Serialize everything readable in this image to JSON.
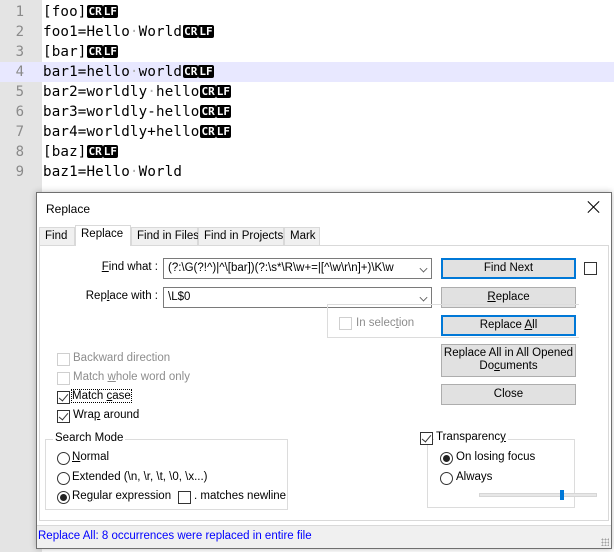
{
  "editor": {
    "current_line": 4,
    "eol_markers": [
      "CR",
      "LF"
    ],
    "lines": [
      {
        "num": "1",
        "text": "[foo]",
        "eol": true
      },
      {
        "num": "2",
        "text": "foo1=Hello·World",
        "eol": true
      },
      {
        "num": "3",
        "text": "[bar]",
        "eol": true
      },
      {
        "num": "4",
        "text": "bar1=hello·world",
        "eol": true
      },
      {
        "num": "5",
        "text": "bar2=worldly·hello",
        "eol": true
      },
      {
        "num": "6",
        "text": "bar3=worldly-hello",
        "eol": true
      },
      {
        "num": "7",
        "text": "bar4=worldly+hello",
        "eol": true
      },
      {
        "num": "8",
        "text": "[baz]",
        "eol": true
      },
      {
        "num": "9",
        "text": "baz1=Hello·World",
        "eol": false
      }
    ]
  },
  "dialog": {
    "title": "Replace",
    "close_icon": "close-icon",
    "tabs": [
      {
        "label": "Find",
        "active": false
      },
      {
        "label": "Replace",
        "active": true
      },
      {
        "label": "Find in Files",
        "active": false
      },
      {
        "label": "Find in Projects",
        "active": false
      },
      {
        "label": "Mark",
        "active": false
      }
    ],
    "find_what_label": "Find what :",
    "find_what_value": "(?:\\G(?!^)|^\\[bar])(?:\\s*\\R\\w+=|[^\\w\\r\\n]+)\\K\\w",
    "replace_with_label": "Replace with :",
    "replace_with_value": "\\L$0",
    "buttons": {
      "find_next": "Find Next",
      "replace": "Replace",
      "replace_all": "Replace All",
      "replace_all_opened": "Replace All in All Opened Documents",
      "close": "Close"
    },
    "in_selection": {
      "label": "In selection",
      "checked": false,
      "enabled": false
    },
    "options": [
      {
        "label": "Backward direction",
        "checked": false,
        "enabled": false
      },
      {
        "label": "Match whole word only",
        "checked": false,
        "enabled": false
      },
      {
        "label": "Match case",
        "checked": true,
        "enabled": true
      },
      {
        "label": "Wrap around",
        "checked": true,
        "enabled": true
      }
    ],
    "search_mode": {
      "title": "Search Mode",
      "options": [
        {
          "label": "Normal",
          "selected": false
        },
        {
          "label": "Extended (\\n, \\r, \\t, \\0, \\x...)",
          "selected": false
        },
        {
          "label": "Regular expression",
          "selected": true
        }
      ],
      "matches_newline": {
        "label": ". matches newline",
        "checked": false
      }
    },
    "transparency": {
      "label": "Transparency",
      "checked": true,
      "options": [
        {
          "label": "On losing focus",
          "selected": true
        },
        {
          "label": "Always",
          "selected": false
        }
      ],
      "slider_value_percent": 70
    },
    "status": "Replace All: 8 occurrences were replaced in entire file"
  }
}
